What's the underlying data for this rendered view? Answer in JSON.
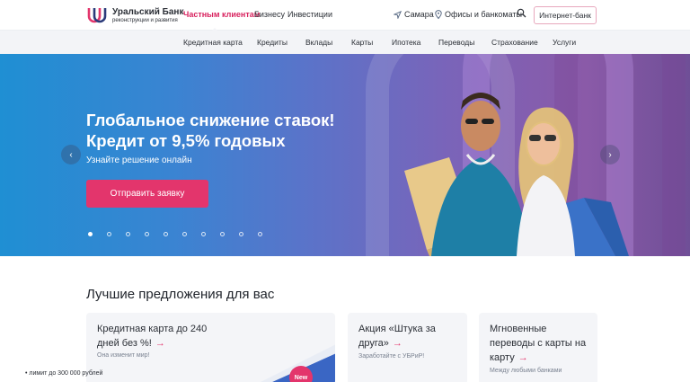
{
  "brand": {
    "name": "Уральский Банк",
    "tagline": "реконструкции и развития",
    "accent_color": "#e3356c"
  },
  "top_nav": {
    "items": [
      {
        "label": "Частным клиентам",
        "active": true
      },
      {
        "label": "Бизнесу",
        "active": false
      },
      {
        "label": "Инвестиции",
        "active": false
      }
    ],
    "city": "Самара",
    "offices": "Офисы и банкоматы",
    "internet_bank": "Интернет-банк"
  },
  "sub_nav": {
    "items": [
      "Кредитная карта",
      "Кредиты",
      "Вклады",
      "Карты",
      "Ипотека",
      "Переводы",
      "Страхование",
      "Услуги"
    ]
  },
  "hero": {
    "title_line1": "Глобальное снижение ставок!",
    "title_line2": "Кредит от 9,5% годовых",
    "subtitle": "Узнайте решение онлайн",
    "cta": "Отправить заявку",
    "prev": "‹",
    "next": "›",
    "slides_total": 10,
    "active_slide": 1
  },
  "offers": {
    "title": "Лучшие предложения для вас",
    "cards": [
      {
        "title_line1": "Кредитная карта до 240",
        "title_line2": "дней без %!",
        "desc": "Она изменит мир!",
        "bullet": "• лимит до 300 000 рублей",
        "badge": "New"
      },
      {
        "title_line1": "Акция «Штука за",
        "title_line2": "друга»",
        "desc": "Заработайте с УБРиР!"
      },
      {
        "title_line1": "Мгновенные",
        "title_line2": "переводы с карты на",
        "title_line3": "карту",
        "desc": "Между любыми банками"
      }
    ]
  }
}
